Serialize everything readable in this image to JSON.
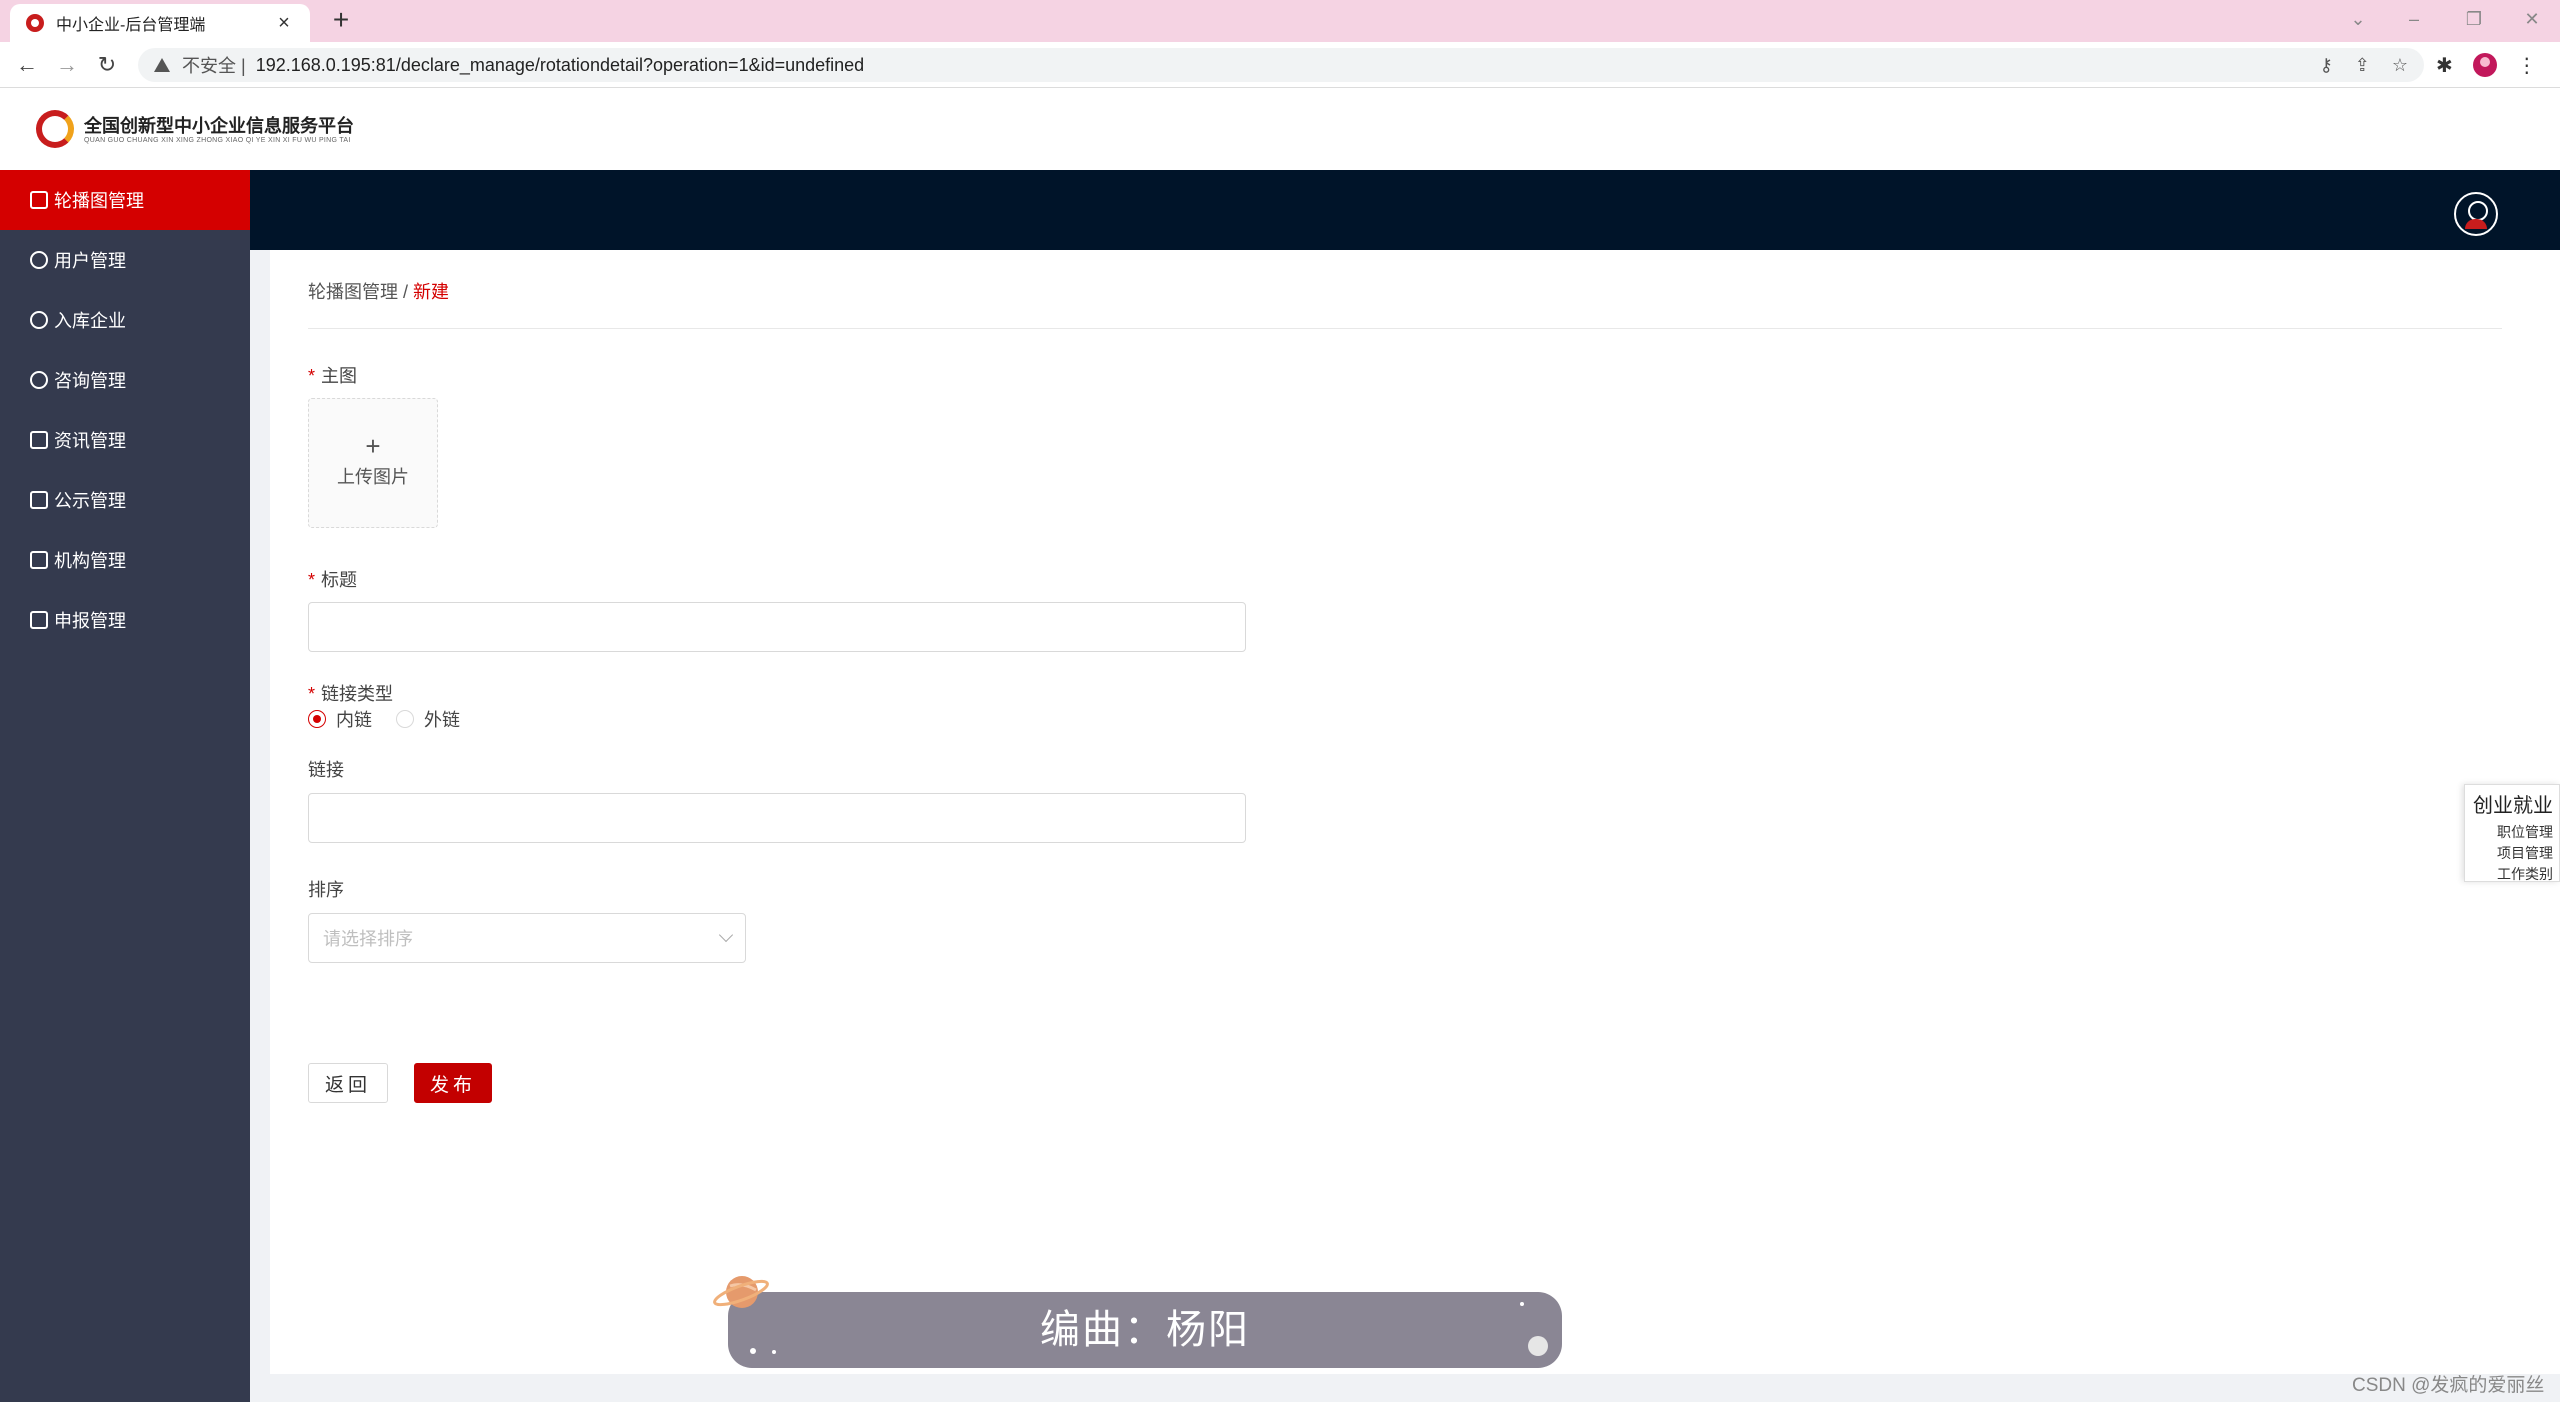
{
  "browser": {
    "tab_title": "中小企业-后台管理端",
    "close_glyph": "×",
    "new_tab_glyph": "+",
    "back_glyph": "←",
    "forward_glyph": "→",
    "reload_glyph": "↻",
    "insecure_label": "不安全 |",
    "url": "192.168.0.195:81/declare_manage/rotationdetail?operation=1&id=undefined",
    "win_chevron": "⌄",
    "win_minimize": "–",
    "win_restore": "❐",
    "win_close": "✕",
    "key_glyph": "⚷",
    "share_glyph": "⇪",
    "star_glyph": "☆",
    "extensions_glyph": "✱",
    "menu_glyph": "⋮"
  },
  "logo": {
    "title": "全国创新型中小企业信息服务平台",
    "subtitle": "QUAN GUO CHUANG XIN XING ZHONG XIAO QI YE XIN XI FU WU PING TAI"
  },
  "sidebar": {
    "items": [
      {
        "label": "轮播图管理",
        "active": true
      },
      {
        "label": "用户管理",
        "active": false
      },
      {
        "label": "入库企业",
        "active": false
      },
      {
        "label": "咨询管理",
        "active": false
      },
      {
        "label": "资讯管理",
        "active": false
      },
      {
        "label": "公示管理",
        "active": false
      },
      {
        "label": "机构管理",
        "active": false
      },
      {
        "label": "申报管理",
        "active": false
      }
    ]
  },
  "breadcrumb": {
    "parent": "轮播图管理",
    "separator": " / ",
    "current": "新建"
  },
  "form": {
    "required_mark": "*",
    "main_image_label": "主图",
    "upload_plus": "+",
    "upload_text": "上传图片",
    "title_label": "标题",
    "title_value": "",
    "link_type_label": "链接类型",
    "link_type_options": [
      "内链",
      "外链"
    ],
    "link_type_selected": "内链",
    "link_label": "链接",
    "link_value": "",
    "sort_label": "排序",
    "sort_placeholder": "请选择排序",
    "back_button": "返回",
    "publish_button": "发布"
  },
  "float_panel": {
    "title": "创业就业",
    "items": [
      "职位管理",
      "项目管理",
      "工作类别"
    ]
  },
  "music": {
    "text": "编曲：杨阳"
  },
  "watermark": "CSDN @发疯的爱丽丝",
  "colors": {
    "accent": "#d40000",
    "sidebar_bg": "#343a4e",
    "topbar_bg": "#001429",
    "tabbar_bg": "#f5d3e3"
  }
}
